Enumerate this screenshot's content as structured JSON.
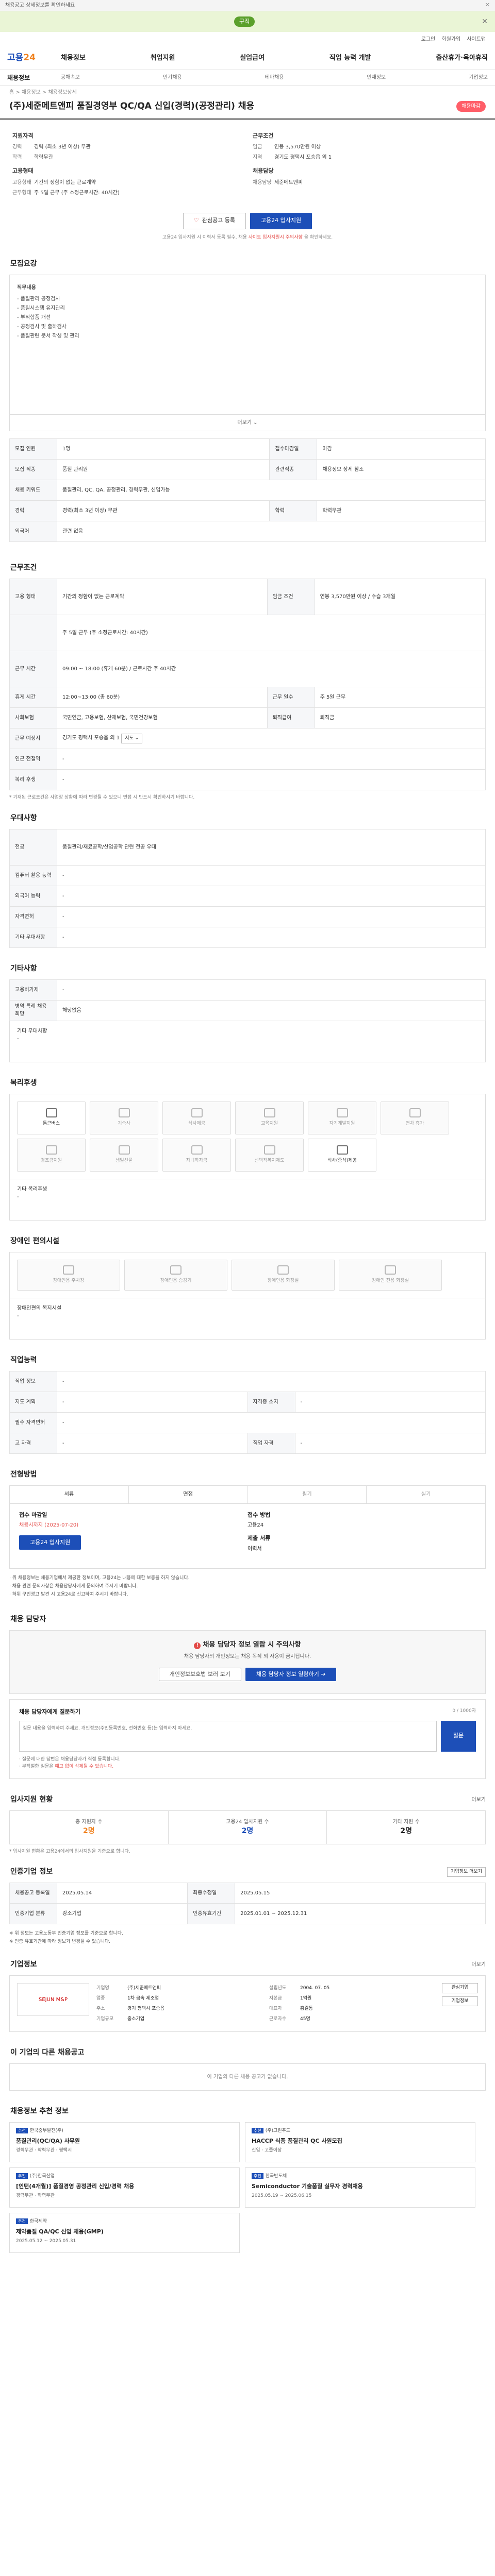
{
  "topbar": {
    "text": "채용공고 상세정보를 확인하세요",
    "close": "✕"
  },
  "promo": {
    "tag": "구직",
    "close": "✕"
  },
  "utility": [
    "로그인",
    "회원가입",
    "사이트맵"
  ],
  "logo": {
    "a": "고용",
    "b": "24"
  },
  "gnb": [
    "채용정보",
    "취업지원",
    "실업급여",
    "직업 능력 개발",
    "출산휴가·육아휴직"
  ],
  "subnav": {
    "title": "채용정보",
    "items": [
      "공채속보",
      "인기채용",
      "테마채용",
      "인재정보",
      "기업정보"
    ]
  },
  "breadcrumb": "홈 > 채용정보 > 채용정보상세",
  "job": {
    "title": "(주)세준메트앤피 품질경영부 QC/QA 신입(경력)(공정관리) 채용",
    "badge": "채용마감"
  },
  "summary": {
    "left": {
      "h1": "지원자격",
      "rows": [
        [
          "경력",
          "경력 (최소 3년 이상) 무관"
        ],
        [
          "학력",
          "학력무관"
        ]
      ],
      "h2": "고용형태",
      "rows2": [
        [
          "고용형태",
          "기간의 정함이 없는 근로계약"
        ],
        [
          "근무형태",
          "주 5일 근무 (주 소정근로시간: 40시간)"
        ]
      ]
    },
    "right": {
      "h1": "근무조건",
      "rows": [
        [
          "임금",
          "연봉 3,570만원 이상"
        ],
        [
          "지역",
          "경기도 평택시 포승읍 외 1"
        ]
      ],
      "h2": "채용담당",
      "rows2": [
        [
          "채용담당",
          "세준메트앤피"
        ]
      ]
    }
  },
  "buttons": {
    "scrap": "관심공고 등록",
    "apply": "고용24 입사지원"
  },
  "note": {
    "a": "고용24 입사지원 시 이력서 등록 필수, 채용 ",
    "b": "사이트 입사지원시 주의사항",
    "c": " 을 확인하세요."
  },
  "s1": {
    "title": "모집요강",
    "intro": "직무내용",
    "lines": [
      "- 품질관리 공정검사",
      "- 품질시스템 유지관리",
      "- 부적합품 개선",
      "- 공정검사 및 출하검사",
      "- 품질관련 문서 작성 및 관리"
    ],
    "more": "더보기 ⌄"
  },
  "s1t": [
    [
      "모집 인원",
      "1명",
      "접수마감일",
      "마감"
    ],
    [
      "모집 직종",
      "품질 관리원",
      "관련직종",
      "채용정보 상세 참조"
    ],
    [
      "채용 키워드",
      "품질관리, QC, QA, 공정관리, 경력무관, 신입가능",
      "",
      ""
    ],
    [
      "경력",
      "경력(최소 3년 이상) 무관",
      "학력",
      "학력무관"
    ],
    [
      "외국어",
      "관련 없음",
      "",
      ""
    ]
  ],
  "s2": {
    "title": "근무조건"
  },
  "s2t": [
    [
      "고용 형태",
      "기간의 정함이 없는 근로계약",
      "임금 조건",
      "연봉 3,570만원 이상 / 수습 3개월"
    ],
    [
      "",
      "주 5일 근무 (주 소정근로시간: 40시간)",
      "",
      ""
    ],
    [
      "근무 시간",
      "09:00 ~ 18:00 (휴게 60분) / 근로시간 주 40시간",
      "",
      ""
    ],
    [
      "휴게 시간",
      "12:00~13:00 (총 60분)",
      "근무 일수",
      "주 5일 근무"
    ],
    [
      "사회보험",
      "국민연금, 고용보험, 산재보험, 국민건강보험",
      "퇴직급여",
      "퇴직금"
    ],
    [
      "근무 예정지",
      "경기도 평택시 포승읍 외 1",
      "",
      ""
    ],
    [
      "인근 전철역",
      "-",
      "",
      ""
    ],
    [
      "복리 후생",
      "-",
      "",
      ""
    ]
  ],
  "s2note": "* 기재된 근로조건은 사업장 상황에 따라 변경될 수 있으니 면접 시 반드시 확인하시기 바랍니다.",
  "s3": {
    "title": "우대사항"
  },
  "s3t": [
    [
      "전공",
      "품질관리/재료공학/산업공학 관련 전공 우대"
    ],
    [
      "컴퓨터 활용 능력",
      "-"
    ],
    [
      "외국어 능력",
      "-"
    ],
    [
      "자격면허",
      "-"
    ],
    [
      "기타 우대사항",
      "-"
    ]
  ],
  "s4": {
    "title": "기타사항"
  },
  "s4t": [
    [
      "고용허가제",
      "-"
    ],
    [
      "병역 특례 채용 희망",
      "해당없음"
    ]
  ],
  "s4etc": {
    "label": "기타 우대사항",
    "val": "-"
  },
  "s5": {
    "title": "복리후생",
    "cards": [
      "통근버스",
      "기숙사",
      "식사제공",
      "교육지원",
      "자기계발지원",
      "연차 휴가",
      "경조금지원",
      "생일선물",
      "자녀학자금",
      "선택적복지제도",
      "식사(중식)제공"
    ],
    "row3": [],
    "etcLabel": "기타 복리후생",
    "etcVal": "-"
  },
  "s6": {
    "title": "장애인 편의시설",
    "cards": [
      "장애인용 주차장",
      "장애인용 승강기",
      "장애인용 화장실",
      "장애인 전용 화장실"
    ],
    "etcLabel": "장애인편의 복지시설",
    "etcVal": "-"
  },
  "s7": {
    "title": "직업능력"
  },
  "s7t": [
    [
      "직업 정보",
      "-",
      "",
      ""
    ],
    [
      "지도 계획",
      "-",
      "자격증 소지",
      "-"
    ],
    [
      "필수 자격면허",
      "-",
      "",
      ""
    ],
    [
      "고 자격",
      "-",
      "직업 자격",
      "-"
    ]
  ],
  "s8": {
    "title": "전형방법",
    "tabs": [
      "서류",
      "면접",
      "필기",
      "실기"
    ],
    "cols": [
      {
        "h": "접수 마감일",
        "v": "채용시까지 (2025-07-20)",
        "btn": "고용24 입사지원"
      },
      {
        "h": "접수 방법",
        "v": "고용24",
        "h2": "제출 서류",
        "v2": "이력서"
      }
    ],
    "notes": [
      "· 위 채용정보는 채용기업에서 제공한 정보이며, 고용24는 내용에 대한 보증을 하지 않습니다.",
      "· 채용 관련 문의사항은 채용담당자에게 문의하여 주시기 바랍니다.",
      "· 허위 구인광고 발견 시 고용24로 신고하여 주시기 바랍니다."
    ]
  },
  "s9": {
    "title": "채용 담당자",
    "warnT": "채용 담당자 정보 열람 시 주의사항",
    "warnD": "채용 담당자의 개인정보는 채용 목적 외 사용이 금지됩니다.",
    "b1": "개인정보보호법 보러 보기",
    "b2": "채용 담당자 정보 열람하기 ➔"
  },
  "qa": {
    "title": "채용 담당자에게 질문하기",
    "hint": "0 / 1000자",
    "ph": "질문 내용을 입력하여 주세요. 개인정보(주민등록번호, 전화번호 등)는 입력하지 마세요.",
    "send": "질문",
    "l1": "· 질문에 대한 답변은 채용담당자가 직접 등록합니다.",
    "l2": "· 부적절한 질문은 ",
    "l2b": "예고 없이 삭제될 수 있습니다.",
    "l3": ""
  },
  "s10": {
    "title": "입사지원 현황",
    "right": "더보기",
    "stats": [
      [
        "총 지원자 수",
        "2명"
      ],
      [
        "고용24 입사지원 수",
        "2명"
      ],
      [
        "기타 지원 수",
        "2명"
      ]
    ],
    "note": "* 입사지원 현황은 고용24에서의 입사지원을 기준으로 합니다."
  },
  "s11": {
    "title": "인증기업 정보",
    "right": "기업정보 더보기",
    "rows": [
      [
        "채용공고 등록일",
        "2025.05.14",
        "최종수정일",
        "2025.05.15"
      ],
      [
        "인증기업 분류",
        "강소기업",
        "인증유효기간",
        "2025.01.01 ~ 2025.12.31"
      ]
    ],
    "notes": [
      "※ 위 정보는 고용노동부 인증기업 정보를 기준으로 합니다.",
      "※ 인증 유효기간에 따라 정보가 변경될 수 있습니다."
    ]
  },
  "s12": {
    "title": "기업정보",
    "right": "더보기",
    "logo": "SEJUN M&P",
    "kv": [
      [
        "기업명",
        "(주)세준메트앤피"
      ],
      [
        "설립년도",
        "2004. 07. 05"
      ],
      [
        "업종",
        "1차 금속 제조업"
      ],
      [
        "자본금",
        "1억원"
      ],
      [
        "주소",
        "경기 평택시 포승읍"
      ],
      [
        "대표자",
        "홍길동"
      ],
      [
        "기업규모",
        "중소기업"
      ],
      [
        "근로자수",
        "45명"
      ]
    ],
    "acts": [
      "관심기업",
      "기업정보"
    ]
  },
  "s13": {
    "title": "이 기업의 다른 채용공고",
    "empty": "이 기업의 다른 채용 공고가 없습니다."
  },
  "s14": {
    "title": "채용정보 추천 정보",
    "items": [
      {
        "co": "한국중부발전(주)",
        "ttl": "품질관리(QC/QA) 사무원",
        "meta": "경력무관 · 학력무관 · 평택시"
      },
      {
        "co": "(주)그린푸드",
        "ttl": "HACCP 식품 품질관리 QC 사원모집",
        "meta": "신입 · 고졸이상"
      },
      {
        "co": "(주)한국산업",
        "ttl": "[인턴(4개월)] 품질경영 공정관리 신입/경력 채용",
        "meta": "경력무관 · 학력무관"
      },
      {
        "co": "한국반도체",
        "ttl": "Semiconductor 기술품질 실무자 경력채용",
        "meta": "2025.05.19 ~ 2025.06.15"
      },
      {
        "co": "한국제약",
        "ttl": "제약품질 QA/QC 신입 채용(GMP)",
        "meta": "2025.05.12 ~ 2025.05.31"
      }
    ]
  }
}
